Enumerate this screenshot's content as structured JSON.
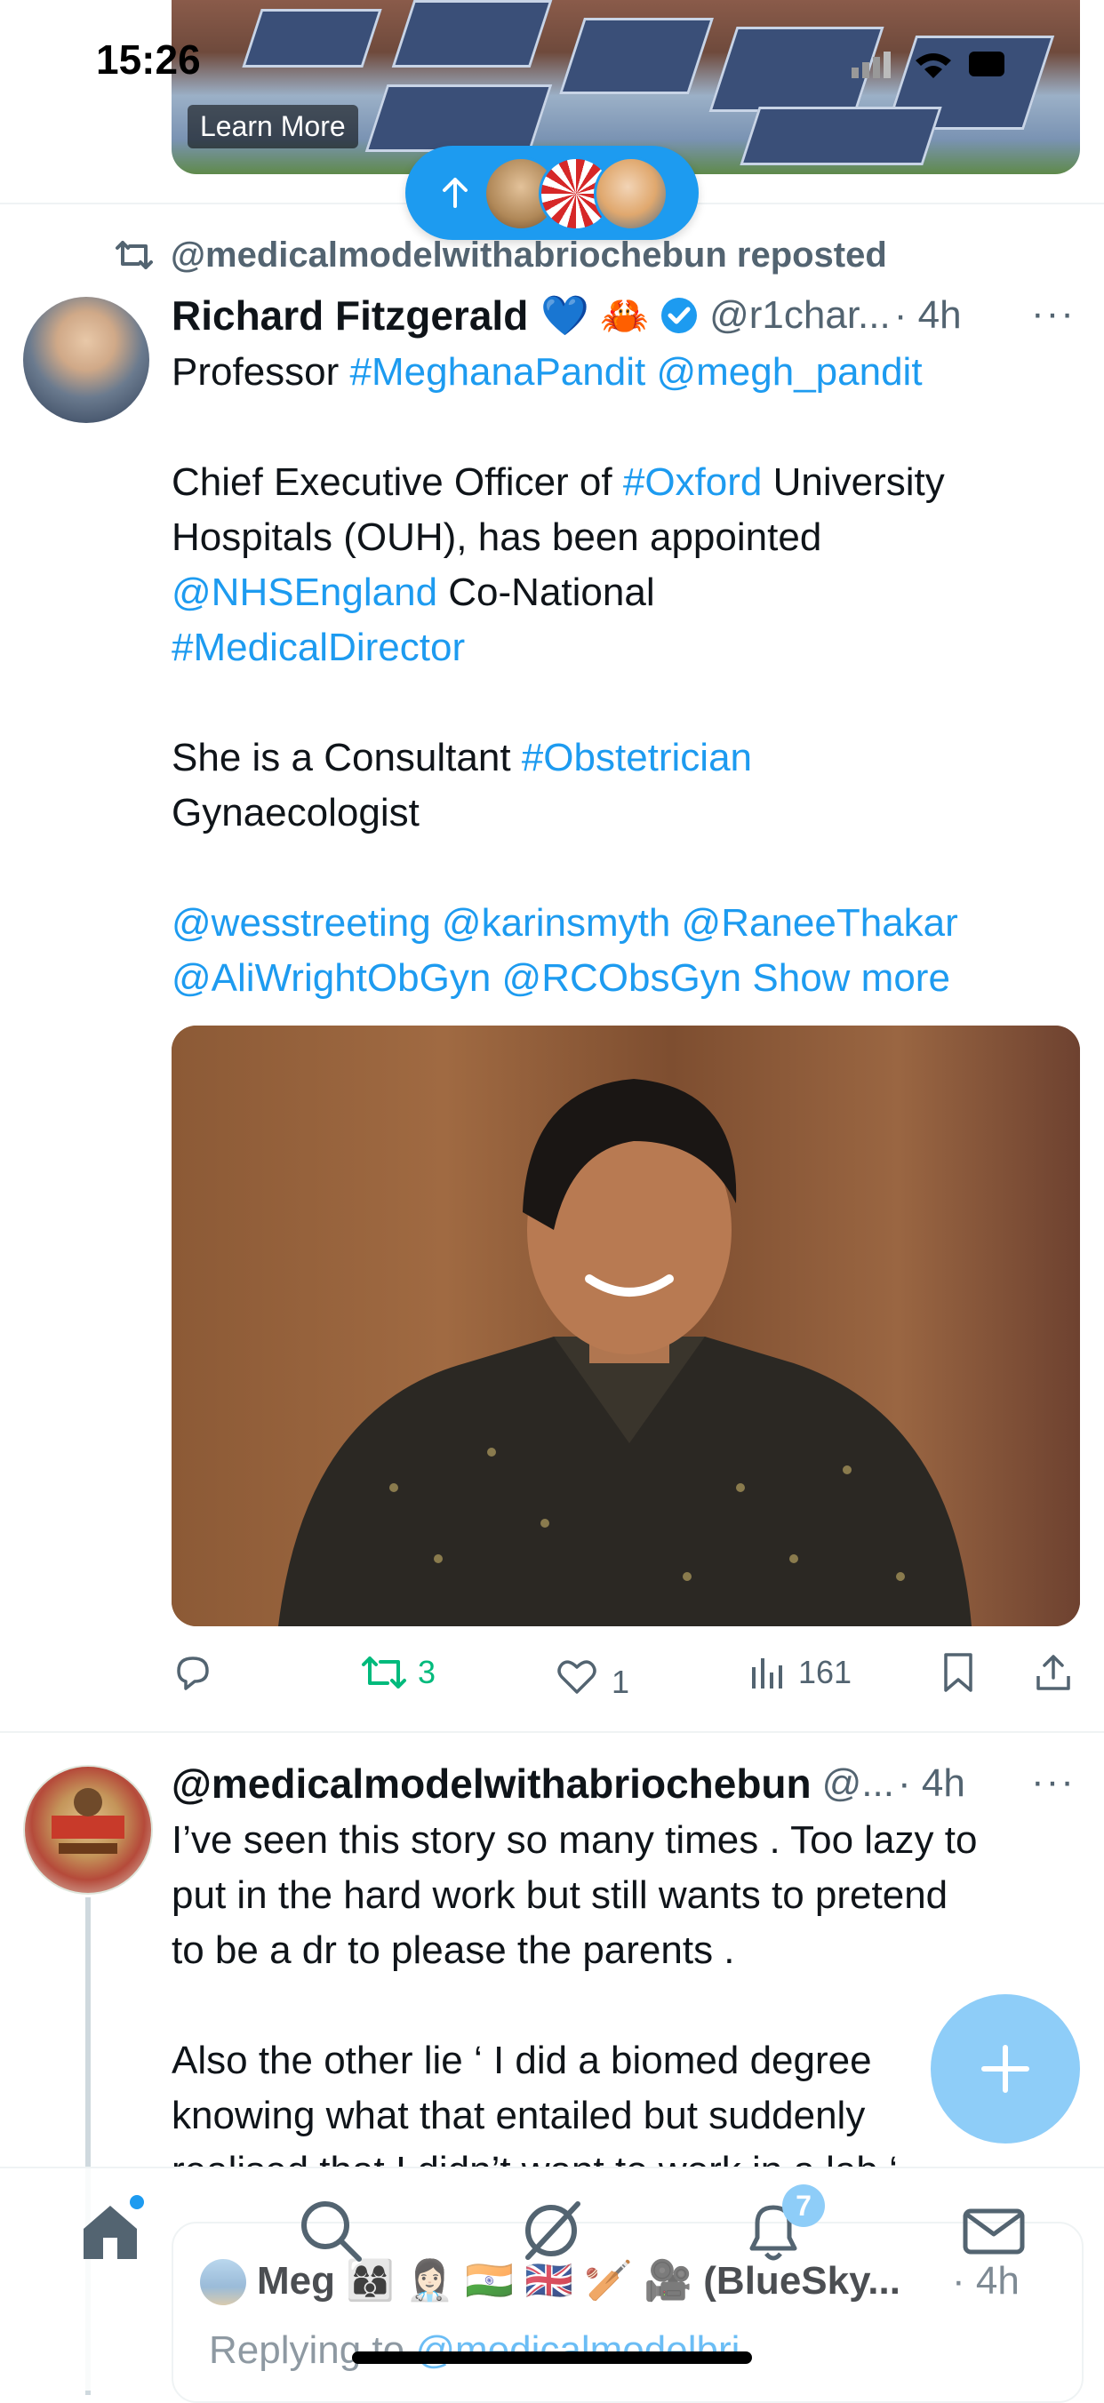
{
  "status_bar": {
    "time": "15:26"
  },
  "ad": {
    "cta": "Learn More"
  },
  "repost": {
    "label": "@medicalmodelwithabriochebun reposted"
  },
  "tweet1": {
    "author_name": "Richard Fitzgerald",
    "author_emojis": "💙 🦀",
    "handle": "@r1char...",
    "time": "· 4h",
    "more": "···",
    "body_parts": [
      {
        "t": "Professor ",
        "link": false
      },
      {
        "t": "#MeghanaPandit",
        "link": true
      },
      {
        "t": " ",
        "link": false
      },
      {
        "t": "@megh_pandit",
        "link": true
      },
      {
        "t": "\n\nChief Executive Officer of ",
        "link": false
      },
      {
        "t": "#Oxford",
        "link": true
      },
      {
        "t": " University\nHospitals (OUH), has been appointed\n",
        "link": false
      },
      {
        "t": "@NHSEngland",
        "link": true
      },
      {
        "t": " Co-National\n",
        "link": false
      },
      {
        "t": "#MedicalDirector",
        "link": true
      },
      {
        "t": "\n\nShe is a Consultant ",
        "link": false
      },
      {
        "t": "#Obstetrician",
        "link": true
      },
      {
        "t": "\nGynaecologist\n\n",
        "link": false
      },
      {
        "t": "@wesstreeting",
        "link": true
      },
      {
        "t": " ",
        "link": false
      },
      {
        "t": "@karinsmyth",
        "link": true
      },
      {
        "t": " ",
        "link": false
      },
      {
        "t": "@RaneeThakar",
        "link": true
      },
      {
        "t": "\n",
        "link": false
      },
      {
        "t": "@AliWrightObGyn",
        "link": true
      },
      {
        "t": " ",
        "link": false
      },
      {
        "t": "@RCObsGyn",
        "link": true
      },
      {
        "t": " ",
        "link": false
      },
      {
        "t": "Show more",
        "link": true
      }
    ],
    "actions": {
      "retweets": "3",
      "likes": "1",
      "views": "161"
    },
    "colors": {
      "retweet_active": "#00ba7c"
    }
  },
  "tweet2": {
    "author_name": "@medicalmodelwithabriochebun",
    "handle": "@...",
    "time": "· 4h",
    "more": "···",
    "body": "I’ve seen this story so many times . Too lazy to\nput in the hard work but still wants to pretend\nto be a dr to please the parents .\n\nAlso the other lie ‘ I did a biomed degree\nknowing what that entailed but suddenly\nrealised that I didn’t want to work in a lab ‘"
  },
  "reply_preview": {
    "author": "Meg 👩‍👩‍👦 👩🏻‍⚕️ 🇮🇳 🇬🇧 🏏 🎥 (BlueSky...",
    "time": "· 4h",
    "replying_prefix": "Replying to ",
    "replying_handle": "@medicalmodelbri"
  },
  "tabbar": {
    "notifications_badge": "7",
    "icons": [
      "home-icon",
      "search-icon",
      "grok-icon",
      "notifications-icon",
      "messages-icon"
    ]
  },
  "colors": {
    "accent": "#1d9bf0",
    "text": "#0f1419",
    "muted": "#536471",
    "fab": "#8ecdf8"
  }
}
